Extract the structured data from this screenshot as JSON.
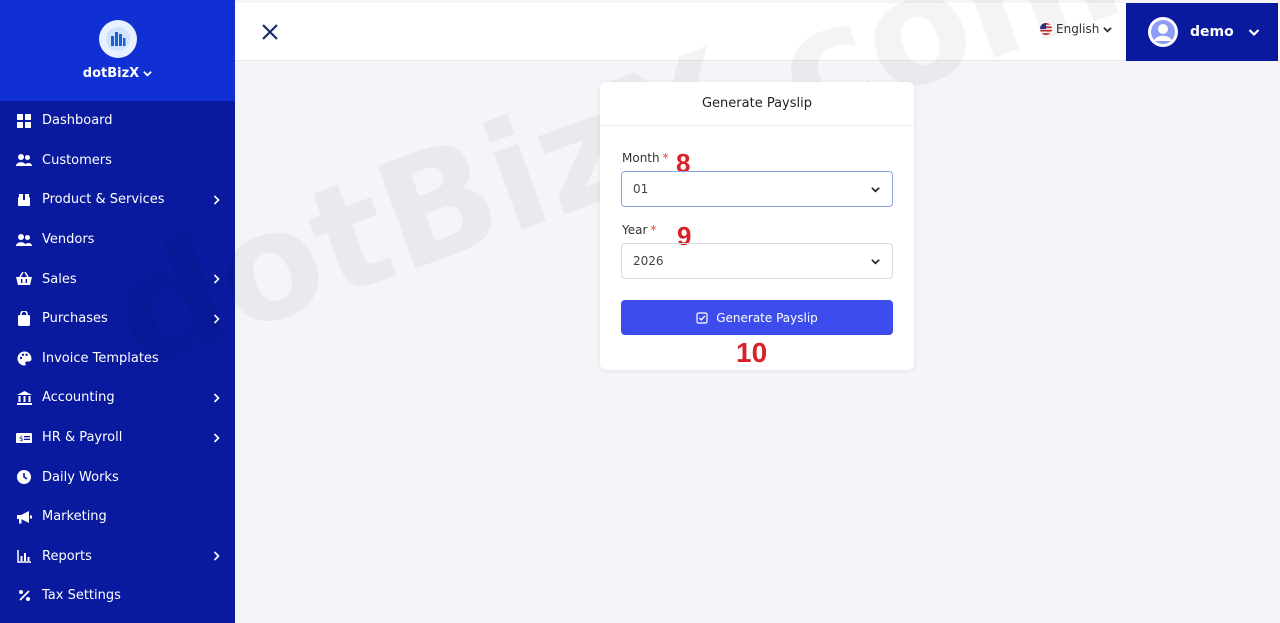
{
  "brand": {
    "name": "dotBizX"
  },
  "sidebar": {
    "items": [
      {
        "label": "Dashboard",
        "icon": "dashboard-icon",
        "has_submenu": false
      },
      {
        "label": "Customers",
        "icon": "users-icon",
        "has_submenu": false
      },
      {
        "label": "Product & Services",
        "icon": "box-icon",
        "has_submenu": true
      },
      {
        "label": "Vendors",
        "icon": "users-icon",
        "has_submenu": false
      },
      {
        "label": "Sales",
        "icon": "basket-icon",
        "has_submenu": true
      },
      {
        "label": "Purchases",
        "icon": "bag-icon",
        "has_submenu": true
      },
      {
        "label": "Invoice Templates",
        "icon": "palette-icon",
        "has_submenu": false
      },
      {
        "label": "Accounting",
        "icon": "bank-icon",
        "has_submenu": true
      },
      {
        "label": "HR & Payroll",
        "icon": "money-icon",
        "has_submenu": true
      },
      {
        "label": "Daily Works",
        "icon": "clock-icon",
        "has_submenu": false
      },
      {
        "label": "Marketing",
        "icon": "megaphone-icon",
        "has_submenu": false
      },
      {
        "label": "Reports",
        "icon": "chart-icon",
        "has_submenu": true
      },
      {
        "label": "Tax Settings",
        "icon": "percent-icon",
        "has_submenu": false
      }
    ]
  },
  "topbar": {
    "language": "English",
    "user": "demo"
  },
  "card": {
    "title": "Generate Payslip",
    "month_label": "Month",
    "month_value": "01",
    "year_label": "Year",
    "year_value": "2026",
    "button_label": "Generate Payslip"
  },
  "annotations": {
    "month_step": "8",
    "year_step": "9",
    "button_step": "10"
  },
  "watermark": "dotBizX.com",
  "colors": {
    "sidebar": "#0a1a9e",
    "brand": "#1130d4",
    "button": "#3d4ded",
    "required": "#e53935",
    "annotation": "#d7222a"
  }
}
